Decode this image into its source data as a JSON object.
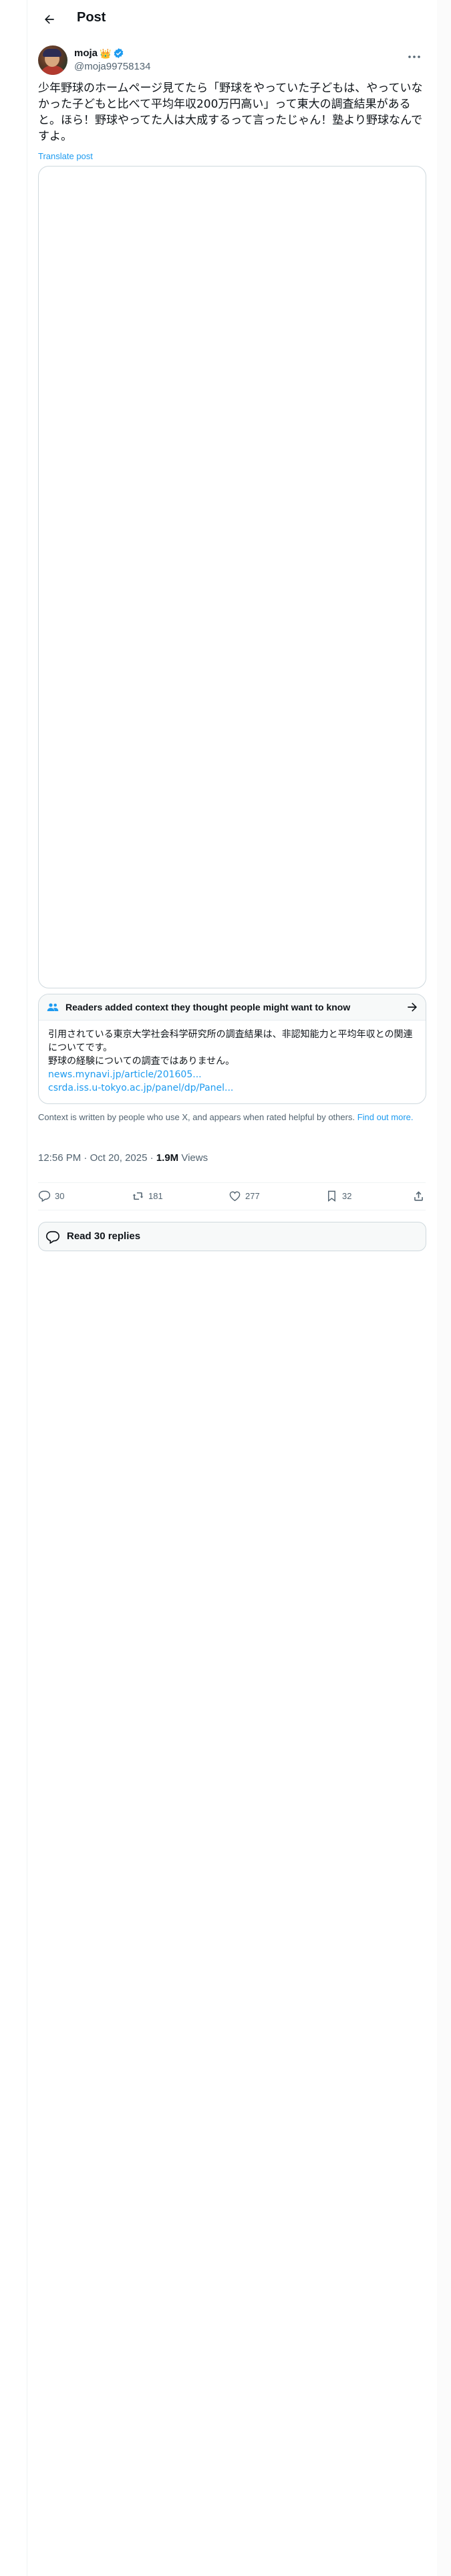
{
  "header": {
    "title": "Post"
  },
  "author": {
    "display_name": "moja",
    "emoji": "👑",
    "handle": "@moja99758134"
  },
  "tweet": {
    "text": "少年野球のホームページ見てたら「野球をやっていた子どもは、やっていなかった子どもと比べて平均年収200万円高い」って東大の調査結果があると。ほら！野球やってた人は大成するって言ったじゃん！塾より野球なんですよ。",
    "translate_label": "Translate post"
  },
  "community_note": {
    "title": "Readers added context they thought people might want to know",
    "body_line1": "引用されている東京大学社会科学研究所の調査結果は、非認知能力と平均年収との関連についてです。",
    "body_line2": "野球の経験についての調査ではありません。",
    "link1": "news.mynavi.jp/article/201605...",
    "link2": "csrda.iss.u-tokyo.ac.jp/panel/dp/Panel..."
  },
  "disclaimer": {
    "text": "Context is written by people who use X, and appears when rated helpful by others.",
    "link": "Find out more."
  },
  "meta": {
    "time": "12:56 PM",
    "date": "Oct 20, 2025",
    "views_count": "1.9M",
    "views_label": "Views"
  },
  "actions": {
    "replies": "30",
    "reposts": "181",
    "likes": "277",
    "bookmarks": "32"
  },
  "read_replies": {
    "label": "Read 30 replies"
  },
  "colors": {
    "accent": "#1d9bf0",
    "text": "#0f1419",
    "muted": "#536471",
    "border": "#cfd9de"
  }
}
